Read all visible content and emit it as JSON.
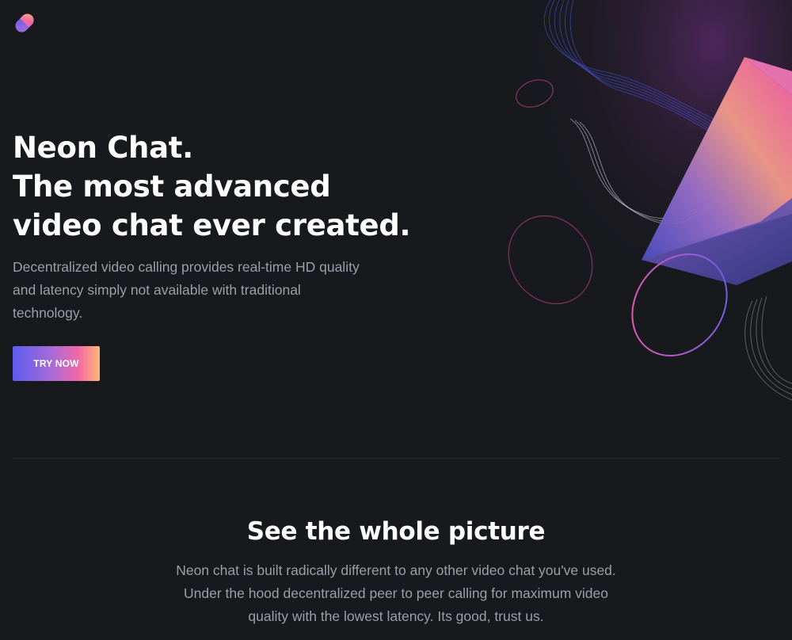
{
  "brand": {
    "logo_icon": "gradient-pill-logo-icon",
    "colors": {
      "background": "#18191d",
      "gradient_start": "#5d5df0",
      "gradient_mid": "#f268a6",
      "gradient_end": "#fdb875",
      "body_text": "#9b9eab",
      "heading_text": "#ffffff"
    }
  },
  "hero": {
    "title_lines": [
      "Neon Chat.",
      "The most advanced",
      "video chat ever created."
    ],
    "description": "Decentralized video calling provides real-time HD quality and latency simply not available with traditional technology.",
    "cta_label": "TRY NOW",
    "illustration_icon": "abstract-neon-shapes-illustration"
  },
  "features": {
    "title": "See the whole picture",
    "description": "Neon chat is built radically different to any other video chat you've used. Under the hood decentralized peer to peer calling for maximum video quality with the lowest latency. Its good, trust us."
  }
}
